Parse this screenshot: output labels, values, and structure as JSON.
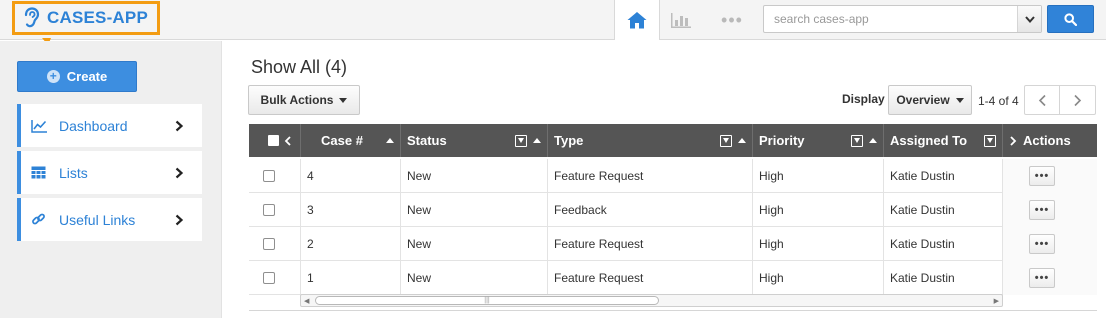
{
  "app": {
    "name": "CASES-APP",
    "accent_color": "#2d82d6",
    "highlight_color": "#f39c12"
  },
  "topnav": {
    "icons": [
      "home-icon",
      "bar-chart-icon",
      "more-dots-icon"
    ],
    "more_glyph": "•••",
    "search_placeholder": "search cases-app"
  },
  "sidebar": {
    "create_label": "Create",
    "items": [
      {
        "label": "Dashboard",
        "icon": "chart-line-icon"
      },
      {
        "label": "Lists",
        "icon": "table-icon"
      },
      {
        "label": "Useful Links",
        "icon": "link-icon"
      }
    ]
  },
  "main": {
    "title": "Show All (4)",
    "bulk_actions_label": "Bulk Actions",
    "display_label": "Display",
    "display_value": "Overview",
    "pager_text": "1-4 of 4"
  },
  "table": {
    "columns": [
      "Case #",
      "Status",
      "Type",
      "Priority",
      "Assigned To",
      "Actions"
    ],
    "rows": [
      {
        "case": "4",
        "status": "New",
        "type": "Feature Request",
        "priority": "High",
        "assigned": "Katie Dustin",
        "actions": "•••"
      },
      {
        "case": "3",
        "status": "New",
        "type": "Feedback",
        "priority": "High",
        "assigned": "Katie Dustin",
        "actions": "•••"
      },
      {
        "case": "2",
        "status": "New",
        "type": "Feature Request",
        "priority": "High",
        "assigned": "Katie Dustin",
        "actions": "•••"
      },
      {
        "case": "1",
        "status": "New",
        "type": "Feature Request",
        "priority": "High",
        "assigned": "Katie Dustin",
        "actions": "•••"
      }
    ]
  }
}
